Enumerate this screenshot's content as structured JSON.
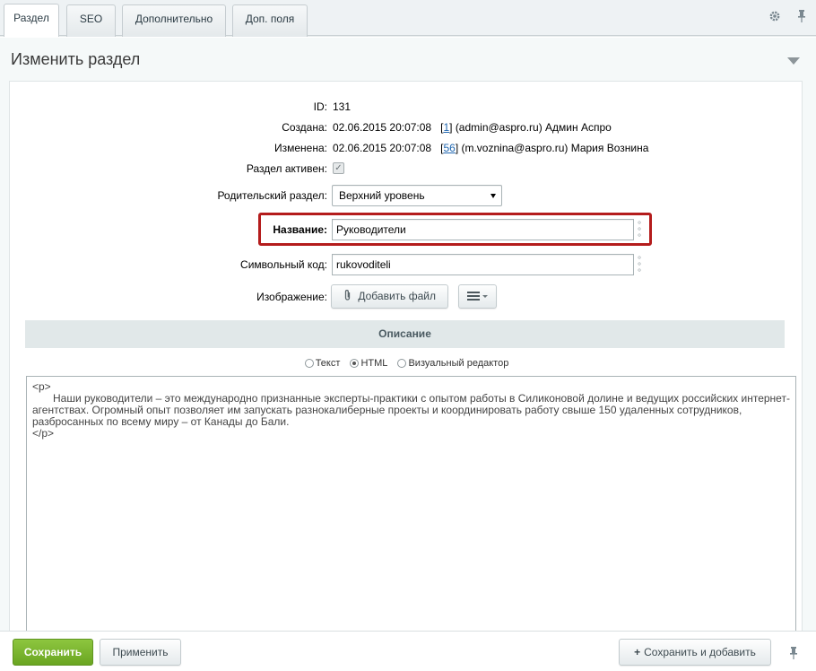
{
  "tabs": [
    {
      "label": "Раздел",
      "active": true
    },
    {
      "label": "SEO",
      "active": false
    },
    {
      "label": "Дополнительно",
      "active": false
    },
    {
      "label": "Доп. поля",
      "active": false
    }
  ],
  "icons": {
    "settings": "gear-icon",
    "pin": "pin-icon"
  },
  "page_title": "Изменить раздел",
  "fields": {
    "id_label": "ID:",
    "id_value": "131",
    "created_label": "Создана:",
    "created_date": "02.06.2015 20:07:08",
    "created_user_id": "1",
    "created_user": "(admin@aspro.ru) Админ Аспро",
    "modified_label": "Изменена:",
    "modified_date": "02.06.2015 20:07:08",
    "modified_user_id": "56",
    "modified_user": "(m.voznina@aspro.ru) Мария Вознина",
    "active_label": "Раздел активен:",
    "active_checked": true,
    "parent_label": "Родительский раздел:",
    "parent_value": "Верхний уровень",
    "name_label": "Название:",
    "name_value": "Руководители",
    "code_label": "Символьный код:",
    "code_value": "rukovoditeli",
    "image_label": "Изображение:",
    "add_file_label": "Добавить файл"
  },
  "description": {
    "section_title": "Описание",
    "modes": [
      {
        "label": "Текст",
        "selected": false
      },
      {
        "label": "HTML",
        "selected": true
      },
      {
        "label": "Визуальный редактор",
        "selected": false
      }
    ],
    "open_tag": "<p>",
    "line1": "Наши руководители – это международно признанные эксперты-практики с опытом работы в Силиконовой долине и ведущих российских интернет-",
    "line2": "агентствах. Огромный опыт позволяет им запускать разнокалиберные проекты и координировать работу свыше 150 удаленных сотрудников,",
    "line3": "разбросанных по всему миру – от Канады до Бали.",
    "close_tag": "</p>"
  },
  "footer": {
    "save_label": "Сохранить",
    "apply_label": "Применить",
    "save_add_label": "Сохранить и добавить"
  },
  "colors": {
    "save_button": "#7ab62f",
    "highlight_border": "#b41c1c",
    "link": "#2067b0"
  }
}
